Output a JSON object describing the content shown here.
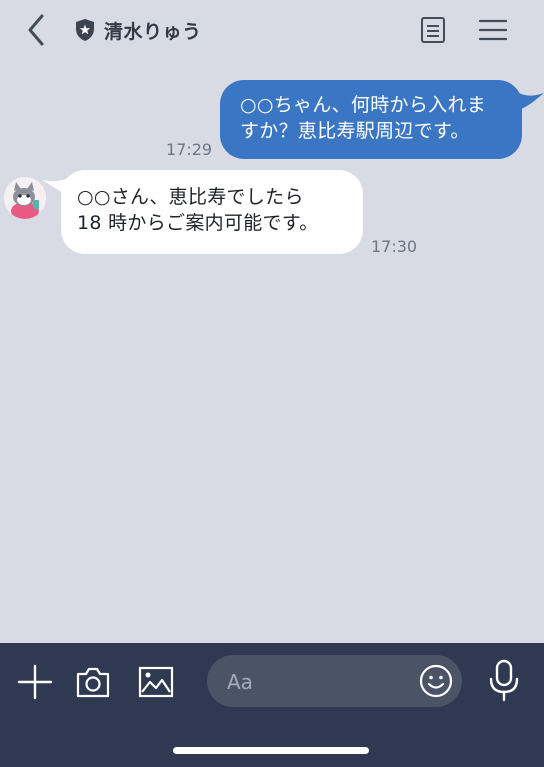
{
  "header": {
    "title": "清水りゅう",
    "icons": [
      "back-chevron-icon",
      "shield-star-icon",
      "note-icon",
      "menu-icon"
    ]
  },
  "messages": [
    {
      "sender": "self",
      "lines": [
        "○○ちゃん、何時から入れま",
        "すか？恵比寿駅周辺です。"
      ],
      "time": "17:29"
    },
    {
      "sender": "other",
      "lines": [
        "○○さん、恵比寿でしたら",
        "18 時からご案内可能です。"
      ],
      "time": "17:30"
    }
  ],
  "input": {
    "placeholder": "Aa"
  },
  "toolbar": {
    "icons": [
      "plus-icon",
      "camera-icon",
      "image-icon",
      "emoji-icon",
      "microphone-icon"
    ]
  },
  "colors": {
    "background": "#d8dbe3",
    "own_bubble": "#3b76c4",
    "other_bubble": "#ffffff",
    "bottom_bar": "#2f3a52",
    "input_pill": "#4b5367"
  }
}
